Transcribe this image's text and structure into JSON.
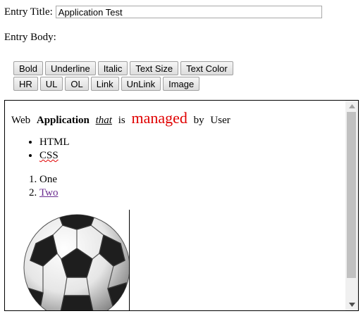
{
  "entry_title": {
    "label": "Entry Title:",
    "value": "Application Test"
  },
  "entry_body": {
    "label": "Entry Body:"
  },
  "toolbar": {
    "row1": [
      "Bold",
      "Underline",
      "Italic",
      "Text Size",
      "Text Color"
    ],
    "row2": [
      "HR",
      "UL",
      "OL",
      "Link",
      "UnLink",
      "Image"
    ]
  },
  "editor": {
    "line1": [
      "Web",
      "Application",
      "that",
      "is",
      "managed",
      "by",
      "User"
    ],
    "bullet_list": [
      "HTML",
      "CSS"
    ],
    "numbered_list": [
      "One",
      "Two"
    ],
    "image": "soccer-ball"
  },
  "colors": {
    "managed_text": "#e00000",
    "visited_link": "#6a2b8f"
  }
}
